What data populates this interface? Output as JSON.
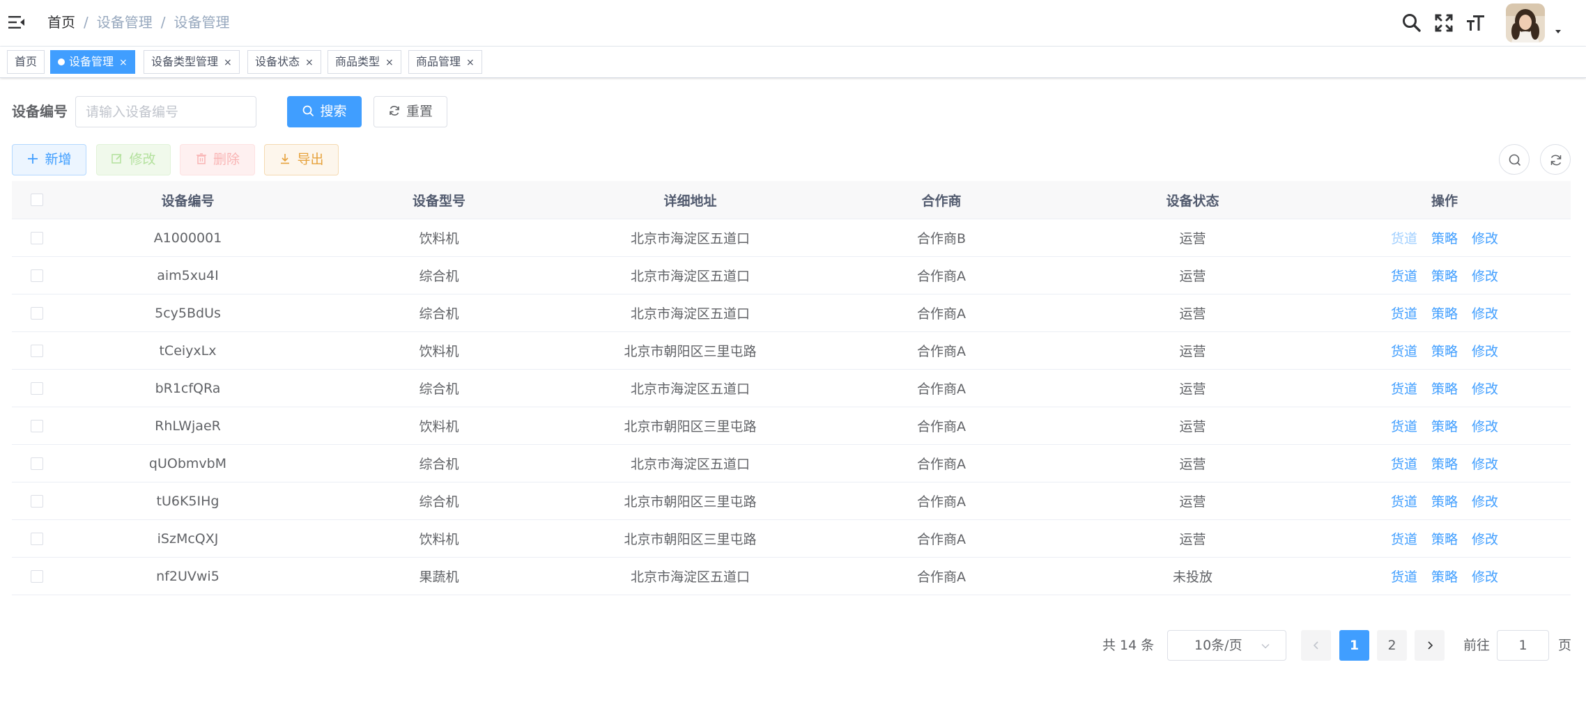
{
  "breadcrumb": [
    "首页",
    "设备管理",
    "设备管理"
  ],
  "breadcrumb_separator": "/",
  "tags": [
    {
      "label": "首页",
      "active": false,
      "closable": false
    },
    {
      "label": "设备管理",
      "active": true,
      "closable": true
    },
    {
      "label": "设备类型管理",
      "active": false,
      "closable": true
    },
    {
      "label": "设备状态",
      "active": false,
      "closable": true
    },
    {
      "label": "商品类型",
      "active": false,
      "closable": true
    },
    {
      "label": "商品管理",
      "active": false,
      "closable": true
    }
  ],
  "close_glyph": "×",
  "search": {
    "label": "设备编号",
    "placeholder": "请输入设备编号",
    "search_button": "搜索",
    "reset_button": "重置"
  },
  "toolbar": {
    "add": "新增",
    "edit": "修改",
    "delete": "删除",
    "export": "导出"
  },
  "table": {
    "headers": [
      "设备编号",
      "设备型号",
      "详细地址",
      "合作商",
      "设备状态",
      "操作"
    ],
    "action_labels": [
      "货道",
      "策略",
      "修改"
    ],
    "rows": [
      [
        "A1000001",
        "饮料机",
        "北京市海淀区五道口",
        "合作商B",
        "运营"
      ],
      [
        "aim5xu4I",
        "综合机",
        "北京市海淀区五道口",
        "合作商A",
        "运营"
      ],
      [
        "5cy5BdUs",
        "综合机",
        "北京市海淀区五道口",
        "合作商A",
        "运营"
      ],
      [
        "tCeiyxLx",
        "饮料机",
        "北京市朝阳区三里屯路",
        "合作商A",
        "运营"
      ],
      [
        "bR1cfQRa",
        "综合机",
        "北京市海淀区五道口",
        "合作商A",
        "运营"
      ],
      [
        "RhLWjaeR",
        "饮料机",
        "北京市朝阳区三里屯路",
        "合作商A",
        "运营"
      ],
      [
        "qUObmvbM",
        "综合机",
        "北京市海淀区五道口",
        "合作商A",
        "运营"
      ],
      [
        "tU6K5IHg",
        "综合机",
        "北京市朝阳区三里屯路",
        "合作商A",
        "运营"
      ],
      [
        "iSzMcQXJ",
        "饮料机",
        "北京市朝阳区三里屯路",
        "合作商A",
        "运营"
      ],
      [
        "nf2UVwi5",
        "果蔬机",
        "北京市海淀区五道口",
        "合作商A",
        "未投放"
      ]
    ]
  },
  "pagination": {
    "total": "共 14 条",
    "page_size": "10条/页",
    "pages": [
      "1",
      "2"
    ],
    "current": "1",
    "goto_label": "前往",
    "goto_value": "1",
    "page_suffix": "页"
  },
  "colors": {
    "primary": "#409eff",
    "success_plain": "#f0f9eb",
    "danger_plain": "#fef0f0",
    "warning": "#e6a23c"
  },
  "icons": {
    "hamburger": "hamburger-icon",
    "search": "search-icon",
    "fullscreen": "fullscreen-icon",
    "font_size": "font-size-icon",
    "refresh": "refresh-icon"
  }
}
